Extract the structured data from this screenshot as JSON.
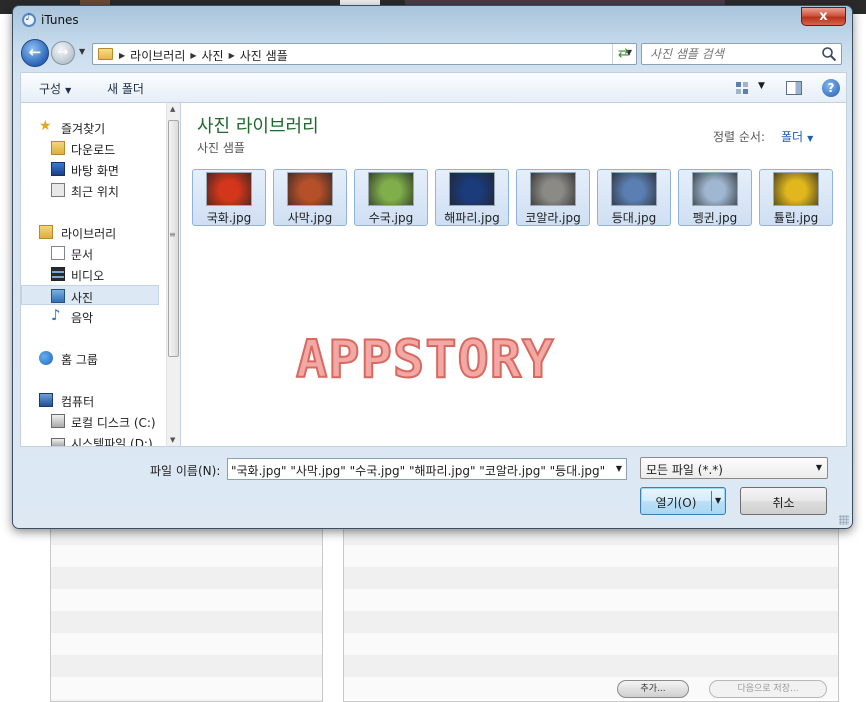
{
  "dialog": {
    "title": "iTunes",
    "close_glyph": "x"
  },
  "address": {
    "crumbs": [
      "라이브러리",
      "사진",
      "사진 샘플"
    ]
  },
  "search": {
    "placeholder": "사진 샘플 검색"
  },
  "toolbar": {
    "organize_label": "구성",
    "new_folder_label": "새 폴더"
  },
  "navpane": {
    "favorites": {
      "header": "즐겨찾기",
      "items": [
        "다운로드",
        "바탕 화면",
        "최근 위치"
      ]
    },
    "libraries": {
      "header": "라이브러리",
      "items": [
        "문서",
        "비디오",
        "사진",
        "음악"
      ],
      "selected": "사진"
    },
    "homegroup": {
      "header": "홈 그룹"
    },
    "computer": {
      "header": "컴퓨터",
      "items": [
        "로컬 디스크 (C:)",
        "시스템파일 (D:)"
      ]
    }
  },
  "content": {
    "library_title": "사진 라이브러리",
    "library_subtitle": "사진 샘플",
    "sort_label": "정렬 순서:",
    "sort_value": "폴더",
    "files": [
      {
        "name": "국화.jpg",
        "color": "#d3361b"
      },
      {
        "name": "사막.jpg",
        "color": "#b5502a"
      },
      {
        "name": "수국.jpg",
        "color": "#7fae4a"
      },
      {
        "name": "해파리.jpg",
        "color": "#1b3b7a"
      },
      {
        "name": "코알라.jpg",
        "color": "#8c8a85"
      },
      {
        "name": "등대.jpg",
        "color": "#5b7fb3"
      },
      {
        "name": "펭귄.jpg",
        "color": "#9fb7d1"
      },
      {
        "name": "튤립.jpg",
        "color": "#e0b81d"
      }
    ],
    "watermark": "APPSTORY"
  },
  "footer": {
    "filename_label": "파일 이름(N):",
    "filename_value": "\"국화.jpg\" \"사막.jpg\" \"수국.jpg\" \"해파리.jpg\" \"코알라.jpg\" \"등대.jpg\" \"",
    "filetype_value": "모든 파일 (*.*)",
    "open_label": "열기(O)",
    "cancel_label": "취소"
  },
  "background_app": {
    "add_button": "추가...",
    "next_button": "다음으로 저장..."
  }
}
